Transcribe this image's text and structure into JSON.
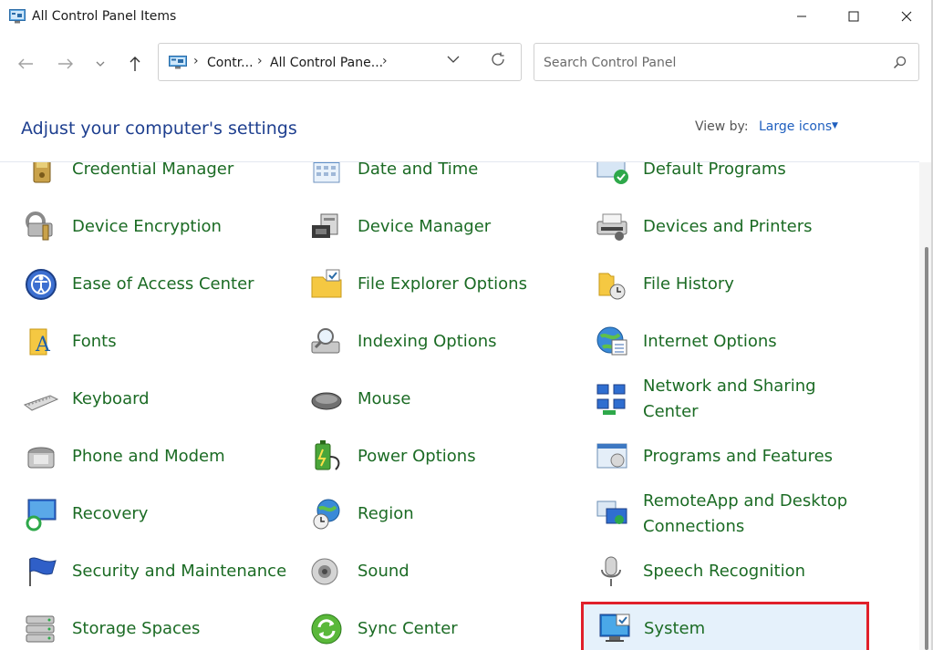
{
  "window": {
    "title": "All Control Panel Items",
    "minimize": "—",
    "maximize": "☐",
    "close": "✕"
  },
  "nav": {
    "back": "←",
    "forward": "→",
    "recent": "⌄",
    "up": "↑"
  },
  "address": {
    "crumbs": [
      "Contr...",
      "All Control Pane..."
    ],
    "separator": "›",
    "dropdown": "⌄",
    "refresh": "↻"
  },
  "search": {
    "placeholder": "Search Control Panel"
  },
  "header": {
    "heading": "Adjust your computer's settings",
    "view_by_label": "View by:",
    "view_by_value": "Large icons",
    "caret": "▼"
  },
  "items": [
    {
      "label": "Credential Manager",
      "icon": "credential-manager-icon"
    },
    {
      "label": "Date and Time",
      "icon": "date-time-icon"
    },
    {
      "label": "Default Programs",
      "icon": "default-programs-icon"
    },
    {
      "label": "Device Encryption",
      "icon": "device-encryption-icon"
    },
    {
      "label": "Device Manager",
      "icon": "device-manager-icon"
    },
    {
      "label": "Devices and Printers",
      "icon": "devices-printers-icon"
    },
    {
      "label": "Ease of Access Center",
      "icon": "ease-of-access-icon"
    },
    {
      "label": "File Explorer Options",
      "icon": "file-explorer-options-icon"
    },
    {
      "label": "File History",
      "icon": "file-history-icon"
    },
    {
      "label": "Fonts",
      "icon": "fonts-icon"
    },
    {
      "label": "Indexing Options",
      "icon": "indexing-options-icon"
    },
    {
      "label": "Internet Options",
      "icon": "internet-options-icon"
    },
    {
      "label": "Keyboard",
      "icon": "keyboard-icon"
    },
    {
      "label": "Mouse",
      "icon": "mouse-icon"
    },
    {
      "label": "Network and Sharing Center",
      "line1": "Network and Sharing",
      "line2": "Center",
      "icon": "network-sharing-icon"
    },
    {
      "label": "Phone and Modem",
      "icon": "phone-modem-icon"
    },
    {
      "label": "Power Options",
      "icon": "power-options-icon"
    },
    {
      "label": "Programs and Features",
      "icon": "programs-features-icon"
    },
    {
      "label": "Recovery",
      "icon": "recovery-icon"
    },
    {
      "label": "Region",
      "icon": "region-icon"
    },
    {
      "label": "RemoteApp and Desktop Connections",
      "line1": "RemoteApp and Desktop",
      "line2": "Connections",
      "icon": "remoteapp-icon"
    },
    {
      "label": "Security and Maintenance",
      "icon": "security-maintenance-icon"
    },
    {
      "label": "Sound",
      "icon": "sound-icon"
    },
    {
      "label": "Speech Recognition",
      "icon": "speech-recognition-icon"
    },
    {
      "label": "Storage Spaces",
      "icon": "storage-spaces-icon"
    },
    {
      "label": "Sync Center",
      "icon": "sync-center-icon"
    },
    {
      "label": "System",
      "icon": "system-icon",
      "selected": true
    }
  ]
}
